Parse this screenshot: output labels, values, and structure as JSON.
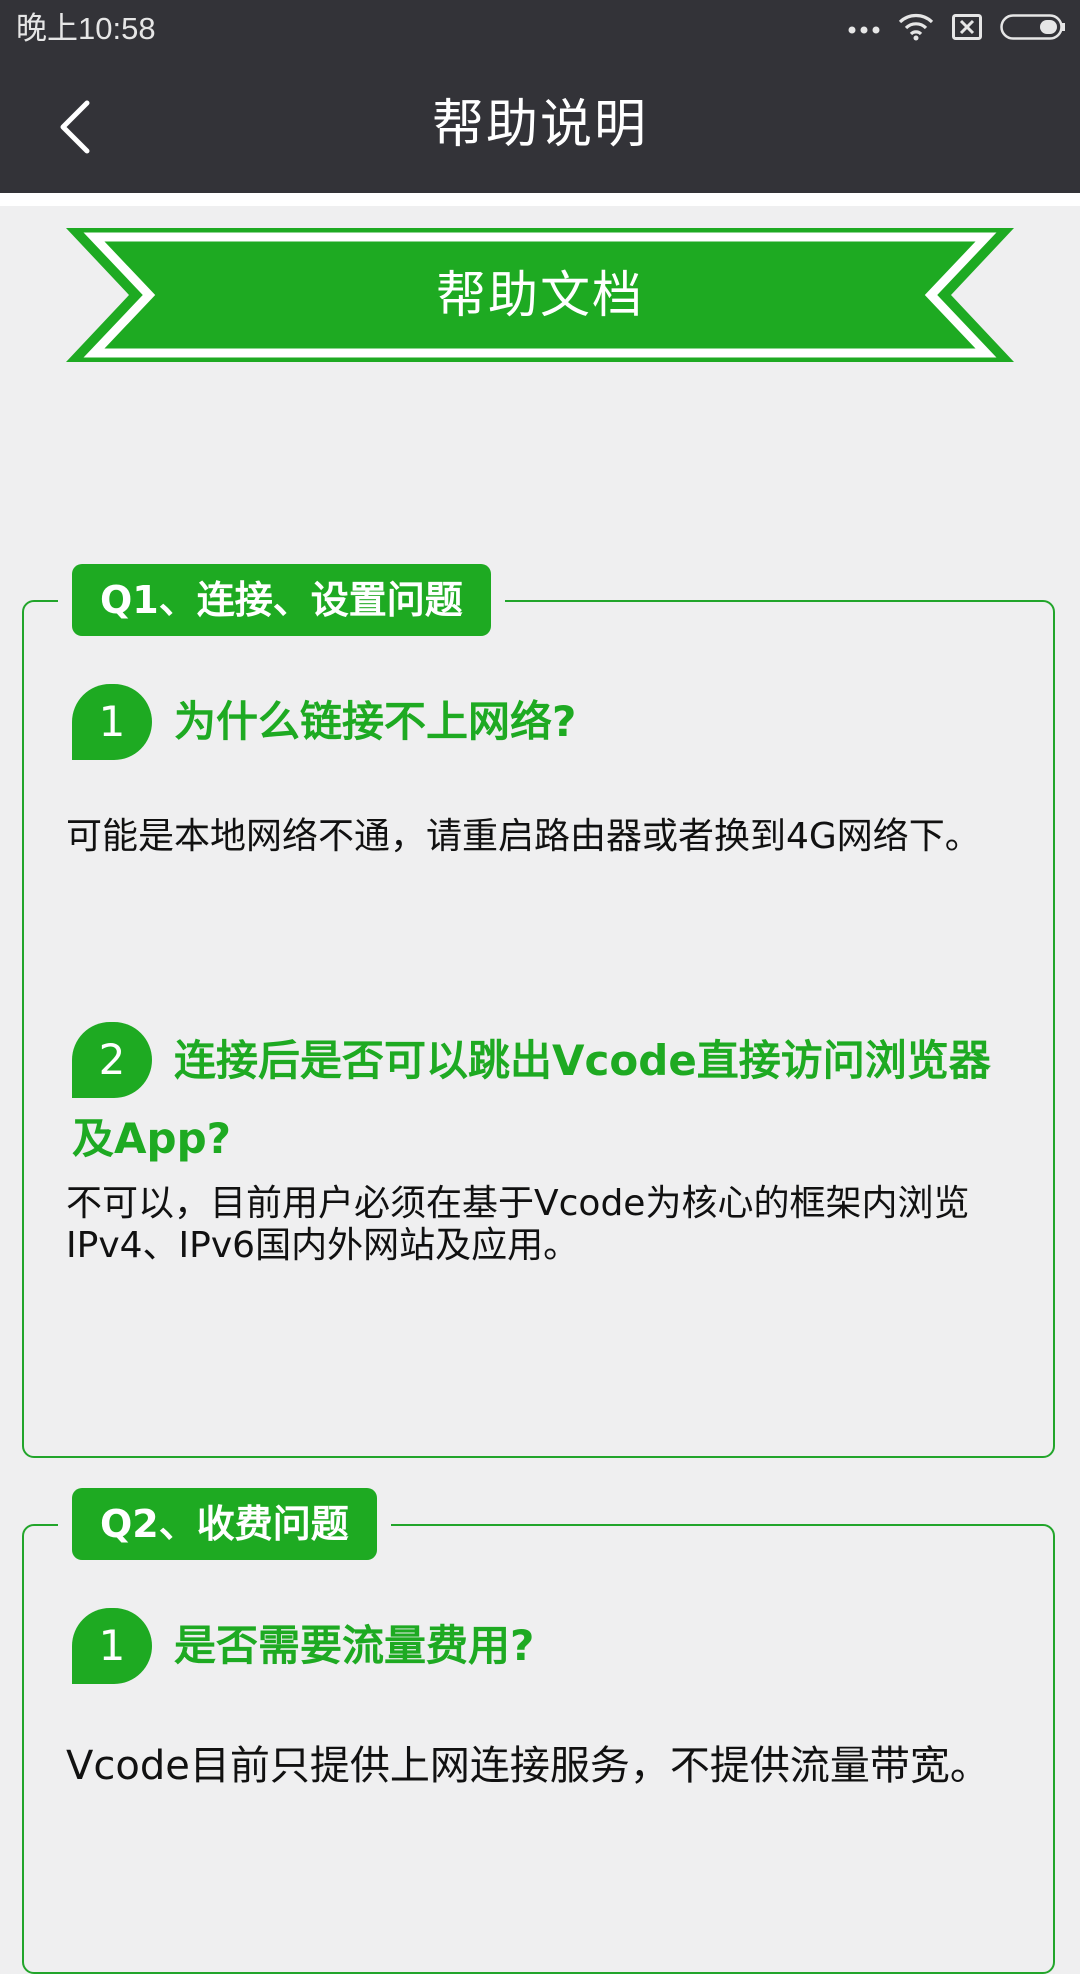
{
  "status": {
    "time": "晚上10:58"
  },
  "header": {
    "title": "帮助说明"
  },
  "banner": {
    "title": "帮助文档",
    "color": "#1eaa22"
  },
  "sections": [
    {
      "label": "Q1、连接、设置问题",
      "questions": [
        {
          "number": "1",
          "title": "为什么链接不上网络?",
          "answer": "可能是本地网络不通，请重启路由器或者换到4G网络下。"
        },
        {
          "number": "2",
          "title": "连接后是否可以跳出Vcode直接访问浏览器及App?",
          "answer": "不可以，目前用户必须在基于Vcode为核心的框架内浏览IPv4、IPv6国内外网站及应用。"
        }
      ]
    },
    {
      "label": "Q2、收费问题",
      "questions": [
        {
          "number": "1",
          "title": "是否需要流量费用?",
          "answer": "Vcode目前只提供上网连接服务，不提供流量带宽。"
        }
      ]
    }
  ],
  "colors": {
    "appbar": "#333338",
    "accent": "#1eaa22",
    "background": "#efeff0"
  },
  "icons": [
    "more-dots-icon",
    "wifi-icon",
    "sim-x-icon",
    "battery-icon",
    "back-arrow-icon"
  ]
}
